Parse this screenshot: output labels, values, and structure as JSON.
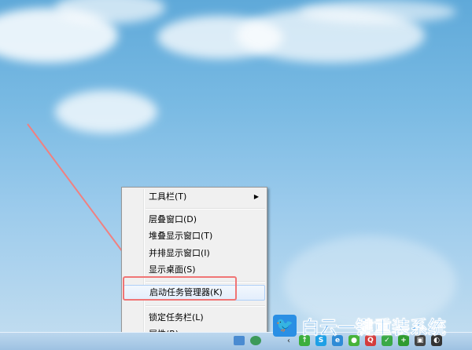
{
  "context_menu": {
    "items": [
      {
        "label": "工具栏(T)",
        "submenu": true
      },
      {
        "label": "层叠窗口(D)"
      },
      {
        "label": "堆叠显示窗口(T)"
      },
      {
        "label": "并排显示窗口(I)"
      },
      {
        "label": "显示桌面(S)"
      },
      {
        "label": "启动任务管理器(K)",
        "highlighted": true
      },
      {
        "label": "锁定任务栏(L)"
      },
      {
        "label": "属性(R)"
      }
    ],
    "submenu_arrow": "▶"
  },
  "annotation": {
    "arrow_color": "#f08080",
    "box_color": "#f07575"
  },
  "watermark": {
    "logo_icon": "twitter-bird-icon",
    "text": "白云一键重装系统"
  },
  "taskbar": {
    "tray_scroll": "‹",
    "tray_icons": [
      {
        "name": "green-up-arrow-icon",
        "color": "#3cae3c",
        "glyph": "↑"
      },
      {
        "name": "skype-icon",
        "color": "#1ea0e6",
        "glyph": "S"
      },
      {
        "name": "ie-icon",
        "color": "#2f8bd6",
        "glyph": "e"
      },
      {
        "name": "wechat-icon",
        "color": "#46b33a",
        "glyph": "●"
      },
      {
        "name": "qq-icon",
        "color": "#d43c3c",
        "glyph": "Q"
      },
      {
        "name": "shield-icon",
        "color": "#3aa948",
        "glyph": "✓"
      },
      {
        "name": "plus-icon",
        "color": "#2f9b2f",
        "glyph": "+"
      },
      {
        "name": "monitor-icon",
        "color": "#444444",
        "glyph": "▣"
      },
      {
        "name": "speaker-icon",
        "color": "#333333",
        "glyph": "◐"
      }
    ]
  }
}
